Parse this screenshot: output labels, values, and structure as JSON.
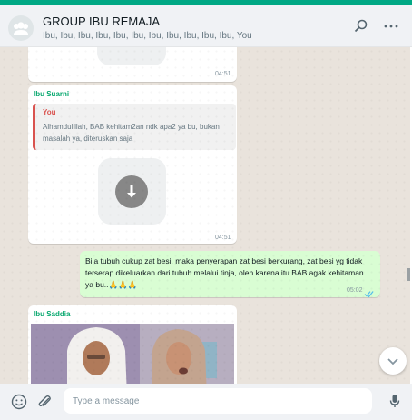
{
  "header": {
    "group_name": "GROUP IBU REMAJA",
    "participants": "Ibu, Ibu, Ibu, Ibu, Ibu, Ibu, Ibu, Ibu, Ibu, Ibu, Ibu, You",
    "icons": [
      "group-avatar-icon",
      "search-icon",
      "menu-icon"
    ]
  },
  "messages": [
    {
      "type": "incoming-image",
      "time": "04:51"
    },
    {
      "type": "incoming-reply",
      "sender": "Ibu Suarni",
      "quoted_author": "You",
      "quoted_text": "Alhamdulillah, BAB kehitam2an ndk apa2 ya bu, bukan masalah ya, diteruskan saja",
      "time": "04:51",
      "icon": "download-icon"
    },
    {
      "type": "outgoing",
      "text": "Bila tubuh cukup zat besi.  maka penyerapan zat besi berkurang, zat besi yg tidak terserap dikeluarkan dari tubuh melalui tinja,  oleh karena itu BAB agak kehitaman ya bu..🙏🙏🙏",
      "time": "05:02",
      "status_icon": "double-check-icon",
      "status_color": "#53bdeb"
    },
    {
      "type": "incoming-image",
      "sender": "Ibu Saddia"
    }
  ],
  "composer": {
    "placeholder": "Type a message",
    "icons": [
      "emoji-icon",
      "attach-icon",
      "mic-icon"
    ]
  },
  "colors": {
    "accent": "#00a884",
    "sender": "#06a86e",
    "quote_bar": "#d9534f",
    "outgoing_bubble": "#d9fdd3"
  }
}
